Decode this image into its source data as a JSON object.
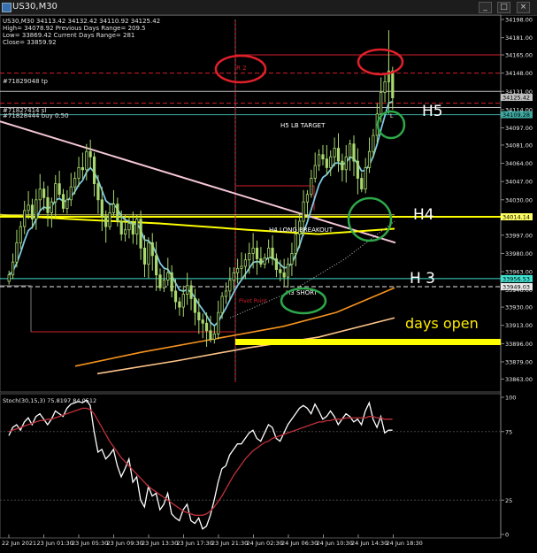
{
  "window": {
    "title": "US30,M30",
    "buttons": [
      "min",
      "max",
      "close"
    ]
  },
  "info_lines": [
    "US30,M30  34113.42 34132.42 34110.92 34125.42",
    "High= 34078.92   Previous Days Range= 209.5",
    "Low= 33869.42   Current Days Range= 281",
    "Close= 33859.92"
  ],
  "order_labels": {
    "tp": "#71829048 tp",
    "sl": "#71827414 sl",
    "buy": "#71828444 buy 0.50"
  },
  "price_tags": [
    {
      "value": "34125.42",
      "color": "#c0c0c0"
    },
    {
      "value": "34109.28",
      "color": "#3fa9a2"
    },
    {
      "value": "34014.14",
      "color": "#ffff66"
    },
    {
      "value": "33956.53",
      "color": "#40e0d0"
    },
    {
      "value": "33949.03",
      "color": "#e8e8e8"
    }
  ],
  "annotations": {
    "h5": "H5",
    "h4": "H4",
    "h3": "H 3",
    "days_open": "days open",
    "h5_target": "H5 LB TARGET",
    "h4_breakout": "H4 LONG BREAKOUT",
    "h3_short": "H3 SHORT",
    "r2": "R 2",
    "pivot": "Pivot Point",
    "long_tag": "L"
  },
  "stoch_label": "Stoch(30,15,3) 75.8197 84.0512",
  "colors": {
    "candle": "#a8d86e",
    "ma_fast": "#7ec8e3",
    "ma_pink": "#f4c6d6",
    "ma_orange": "#f7941d",
    "ma_light_orange": "#ffc58a",
    "level_yellow": "#ffff00",
    "level_red": "#d0202a",
    "circle_red": "#e0202a",
    "circle_green": "#2ea84a",
    "stoch_main": "#ffffff",
    "stoch_signal": "#c0303a"
  },
  "chart_data": [
    {
      "type": "candlestick",
      "title": "US30,M30",
      "ylim": [
        33860,
        34198
      ],
      "y_ticks": [
        34198.0,
        34181.0,
        34165.0,
        34148.0,
        34131.0,
        34114.0,
        34097.0,
        34081.0,
        34064.0,
        34047.0,
        34030.0,
        34014.0,
        33997.0,
        33980.0,
        33963.0,
        33946.0,
        33930.0,
        33913.0,
        33896.0,
        33879.0,
        33863.0
      ],
      "x_tick_labels": [
        "22 Jun 2021",
        "23 Jun 01:30",
        "23 Jun 05:30",
        "23 Jun 09:30",
        "23 Jun 13:30",
        "23 Jun 17:30",
        "23 Jun 21:30",
        "24 Jun 02:30",
        "24 Jun 06:30",
        "24 Jun 10:30",
        "24 Jun 14:30",
        "24 Jun 18:30"
      ],
      "close": [
        33960,
        33972,
        33990,
        34005,
        34020,
        34025,
        34012,
        34030,
        34040,
        34032,
        34018,
        34028,
        34045,
        34035,
        34022,
        34030,
        34042,
        34050,
        34060,
        34058,
        34075,
        34070,
        34045,
        34030,
        34015,
        34005,
        34018,
        34026,
        34010,
        33998,
        34002,
        34008,
        33998,
        34012,
        33985,
        33970,
        33990,
        33978,
        33960,
        33948,
        33955,
        33962,
        33945,
        33935,
        33930,
        33942,
        33950,
        33938,
        33925,
        33918,
        33915,
        33908,
        33900,
        33905,
        33925,
        33940,
        33945,
        33955,
        33962,
        33966,
        33968,
        33974,
        33980,
        33985,
        33975,
        33970,
        33976,
        33985,
        33975,
        33965,
        33962,
        33958,
        33970,
        33980,
        33998,
        34010,
        34028,
        34035,
        34050,
        34062,
        34072,
        34068,
        34060,
        34070,
        34078,
        34066,
        34058,
        34070,
        34082,
        34066,
        34050,
        34040,
        34060,
        34075,
        34090,
        34110,
        34130,
        34140,
        34150,
        34125
      ],
      "levels": [
        {
          "label": "H5 LB TARGET",
          "value": 34109.28
        },
        {
          "label": "H4 LONG BREAKOUT",
          "value": 34014.14
        },
        {
          "label": "H3 SHORT",
          "value": 33956.53
        },
        {
          "label": "R 2",
          "value": 34165.0
        },
        {
          "label": "days open",
          "value": 33907.0
        }
      ]
    },
    {
      "type": "line",
      "title": "Stoch(30,15,3) 75.8197 84.0512",
      "ylim": [
        0,
        100
      ],
      "y_ticks": [
        100,
        75,
        25,
        0
      ],
      "series": [
        {
          "name": "main",
          "values": [
            72,
            78,
            80,
            76,
            82,
            85,
            80,
            86,
            88,
            84,
            80,
            84,
            90,
            88,
            86,
            92,
            95,
            96,
            97,
            96,
            98,
            94,
            75,
            60,
            62,
            55,
            58,
            62,
            50,
            42,
            48,
            55,
            38,
            42,
            25,
            20,
            35,
            28,
            30,
            18,
            22,
            30,
            15,
            12,
            10,
            18,
            22,
            10,
            8,
            12,
            4,
            6,
            14,
            25,
            38,
            48,
            50,
            58,
            62,
            66,
            66,
            70,
            74,
            76,
            70,
            68,
            74,
            80,
            78,
            70,
            68,
            74,
            80,
            84,
            88,
            92,
            94,
            92,
            88,
            95,
            90,
            84,
            86,
            90,
            86,
            80,
            84,
            88,
            86,
            82,
            84,
            80,
            90,
            96,
            84,
            78,
            86,
            74,
            76,
            76
          ]
        },
        {
          "name": "signal",
          "values": [
            75,
            76,
            77,
            78,
            79,
            80,
            81,
            82,
            83,
            83,
            84,
            84,
            85,
            86,
            87,
            88,
            89,
            90,
            91,
            92,
            92,
            91,
            88,
            83,
            78,
            73,
            68,
            64,
            60,
            56,
            53,
            50,
            47,
            44,
            41,
            38,
            35,
            33,
            31,
            29,
            27,
            25,
            23,
            21,
            19,
            17,
            16,
            15,
            14,
            14,
            14,
            15,
            17,
            20,
            24,
            28,
            33,
            38,
            43,
            47,
            51,
            55,
            58,
            61,
            63,
            65,
            67,
            68,
            70,
            71,
            72,
            73,
            74,
            75,
            76,
            77,
            78,
            79,
            80,
            81,
            82,
            82,
            83,
            83,
            84,
            84,
            84,
            85,
            85,
            85,
            85,
            85,
            85,
            86,
            86,
            85,
            85,
            84,
            84,
            84
          ]
        }
      ]
    }
  ]
}
